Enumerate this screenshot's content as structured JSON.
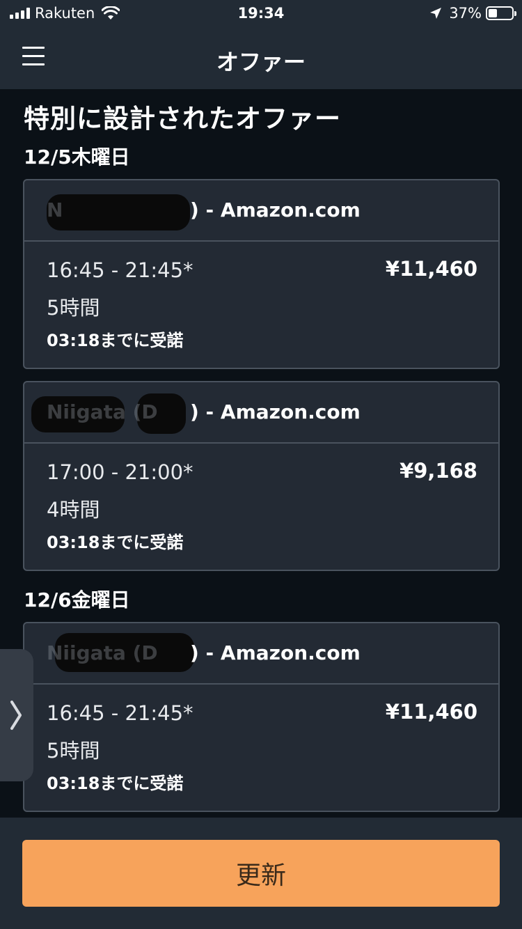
{
  "status_bar": {
    "carrier": "Rakuten",
    "time": "19:34",
    "battery_percent": "37%",
    "battery_level": 0.37,
    "icons": [
      "signal-icon",
      "wifi-icon",
      "location-arrow-icon",
      "battery-icon"
    ]
  },
  "nav": {
    "title": "オファー",
    "menu_icon": "hamburger-menu-icon"
  },
  "heading": "特別に設計されたオファー",
  "groups": [
    {
      "date": "12/5木曜日",
      "offers": [
        {
          "station_prefix": "N",
          "station_suffix": ") - Amazon.com",
          "time_range": "16:45 - 21:45*",
          "duration": "5時間",
          "accept_by": "03:18までに受諾",
          "price": "¥11,460"
        },
        {
          "station_prefix": "Niigata (D",
          "station_suffix": ") - Amazon.com",
          "time_range": "17:00 - 21:00*",
          "duration": "4時間",
          "accept_by": "03:18までに受諾",
          "price": "¥9,168"
        }
      ]
    },
    {
      "date": "12/6金曜日",
      "offers": [
        {
          "station_prefix": "Niigata (D",
          "station_suffix": ") - Amazon.com",
          "time_range": "16:45 - 21:45*",
          "duration": "5時間",
          "accept_by": "03:18までに受諾",
          "price": "¥11,460"
        }
      ]
    }
  ],
  "side_tab_icon": "chevron-right-icon",
  "refresh_button": "更新",
  "colors": {
    "background": "#0b1117",
    "bar": "#222b35",
    "card": "#232a34",
    "card_border": "#4a535e",
    "accent_button": "#f7a35b"
  }
}
